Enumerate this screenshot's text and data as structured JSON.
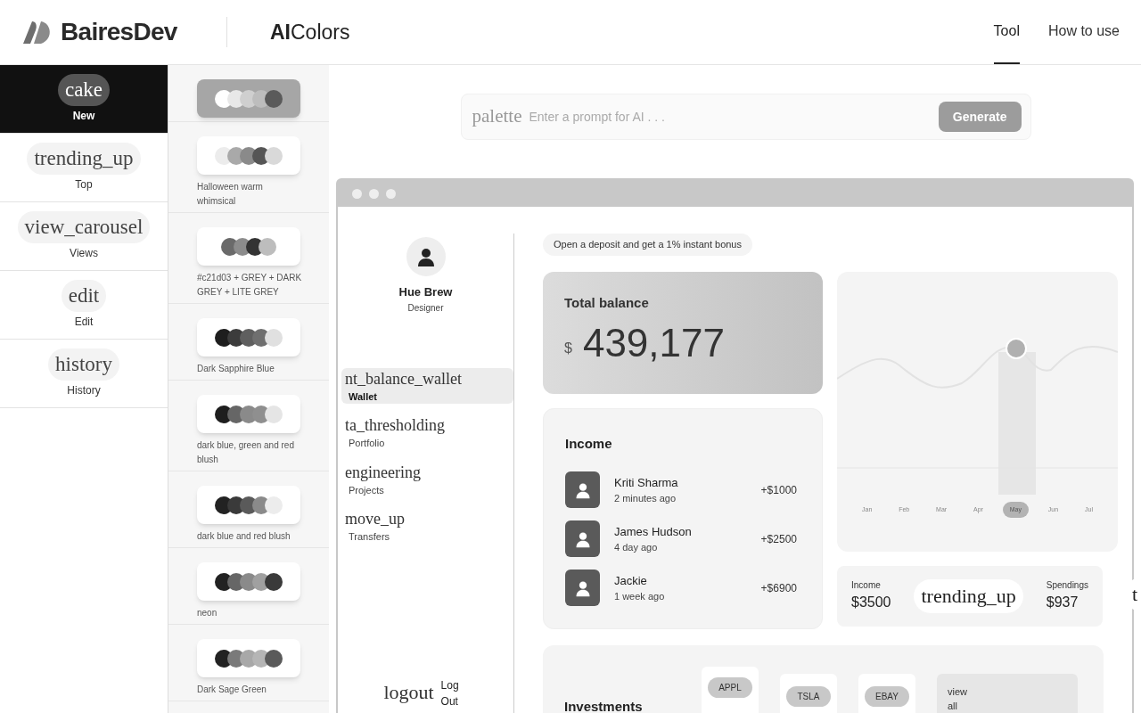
{
  "header": {
    "brand": "BairesDev",
    "app_name": "**AI**Colors",
    "tabs": [
      {
        "label": "Tool",
        "selected": true
      },
      {
        "label": "How to use",
        "selected": false
      }
    ]
  },
  "sidebar": {
    "items": [
      {
        "icon_text": "cake",
        "label": "New",
        "selected": true
      },
      {
        "icon_text": "trending_up",
        "label": "Top",
        "selected": false
      },
      {
        "icon_text": "view_carousel",
        "label": "Views",
        "selected": false
      },
      {
        "icon_text": "edit",
        "label": "Edit",
        "selected": false
      },
      {
        "icon_text": "history",
        "label": "History",
        "selected": false
      }
    ]
  },
  "palettes": [
    {
      "selected": true,
      "swatches": [
        {
          "color": "#ffffff"
        },
        {
          "color": "#e8e8e8"
        },
        {
          "color": "#cfcfcf"
        },
        {
          "color": "#bdbdbd"
        },
        {
          "color": "#5a5a5a"
        }
      ]
    },
    {
      "selected": false,
      "name": "Halloween warm whimsical",
      "swatches": [
        {
          "color": "#ececec"
        },
        {
          "color": "#a9a9a9"
        },
        {
          "color": "#8a8a8a"
        },
        {
          "color": "#555555"
        },
        {
          "color": "#d9d9d9"
        }
      ]
    },
    {
      "selected": false,
      "name": "#c21d03 + GREY + DARK GREY + LITE GREY",
      "swatches": [
        {
          "color": "#6a6a6a"
        },
        {
          "color": "#8c8c8c"
        },
        {
          "color": "#333333"
        },
        {
          "color": "#bdbdbd"
        }
      ]
    },
    {
      "selected": false,
      "name": "Dark Sapphire Blue",
      "swatches": [
        {
          "color": "#1e1e1e"
        },
        {
          "color": "#3c3c3c"
        },
        {
          "color": "#5f5f5f"
        },
        {
          "color": "#6f6f6f"
        },
        {
          "color": "#e0e0e0"
        }
      ]
    },
    {
      "selected": false,
      "name": "dark blue, green and red blush",
      "swatches": [
        {
          "color": "#1e1e1e"
        },
        {
          "color": "#666666"
        },
        {
          "color": "#8a8a8a"
        },
        {
          "color": "#8f8f8f"
        },
        {
          "color": "#e5e5e5"
        }
      ]
    },
    {
      "selected": false,
      "name": "dark blue and red blush",
      "swatches": [
        {
          "color": "#222222"
        },
        {
          "color": "#3a3a3a"
        },
        {
          "color": "#5a5a5a"
        },
        {
          "color": "#8a8a8a"
        },
        {
          "color": "#ececec"
        }
      ]
    },
    {
      "selected": false,
      "name": "neon",
      "swatches": [
        {
          "color": "#222222"
        },
        {
          "color": "#666666"
        },
        {
          "color": "#8a8a8a"
        },
        {
          "color": "#a0a0a0"
        },
        {
          "color": "#3a3a3a"
        }
      ]
    },
    {
      "selected": false,
      "name": "Dark Sage Green",
      "swatches": [
        {
          "color": "#222222"
        },
        {
          "color": "#7a7a7a"
        },
        {
          "color": "#a8a8a8"
        },
        {
          "color": "#b5b5b5"
        },
        {
          "color": "#5a5a5a"
        }
      ]
    }
  ],
  "prompt": {
    "icon_text": "palette",
    "placeholder": "Enter a prompt for AI . . .",
    "button": "Generate"
  },
  "preview": {
    "profile": {
      "name": "Hue Brew",
      "role": "Designer"
    },
    "nav": [
      {
        "icon_text": "nt_balance_wallet",
        "label": "Wallet",
        "selected": true
      },
      {
        "icon_text": "ta_thresholding",
        "label": "Portfolio",
        "selected": false
      },
      {
        "icon_text": "engineering",
        "label": "Projects",
        "selected": false
      },
      {
        "icon_text": "move_up",
        "label": "Transfers",
        "selected": false
      }
    ],
    "logout": {
      "icon_text": "logout",
      "label": "Log Out"
    },
    "promo": "Open a deposit and get a 1% instant bonus",
    "balance": {
      "title": "Total balance",
      "currency": "$",
      "amount": "439,177"
    },
    "income": {
      "title": "Income",
      "rows": [
        {
          "name": "Kriti Sharma",
          "time": "2 minutes ago",
          "amount": "+$1000"
        },
        {
          "name": "James Hudson",
          "time": "4 day ago",
          "amount": "+$2500"
        },
        {
          "name": "Jackie",
          "time": "1 week ago",
          "amount": "+$6900"
        }
      ]
    },
    "chart": {
      "months": [
        {
          "label": "Jan",
          "selected": false
        },
        {
          "label": "Feb",
          "selected": false
        },
        {
          "label": "Mar",
          "selected": false
        },
        {
          "label": "Apr",
          "selected": false
        },
        {
          "label": "May",
          "selected": true
        },
        {
          "label": "Jun",
          "selected": false
        },
        {
          "label": "Jul",
          "selected": false
        }
      ]
    },
    "stats": {
      "income_label": "Income",
      "income_value": "$3500",
      "icon_text": "trending_up",
      "spendings_label": "Spendings",
      "spendings_value": "$937",
      "next_icon_text": "t"
    },
    "investments": {
      "title": "Investments",
      "tickers": [
        "APPL",
        "TSLA",
        "EBAY"
      ],
      "view_all": "view all"
    }
  }
}
